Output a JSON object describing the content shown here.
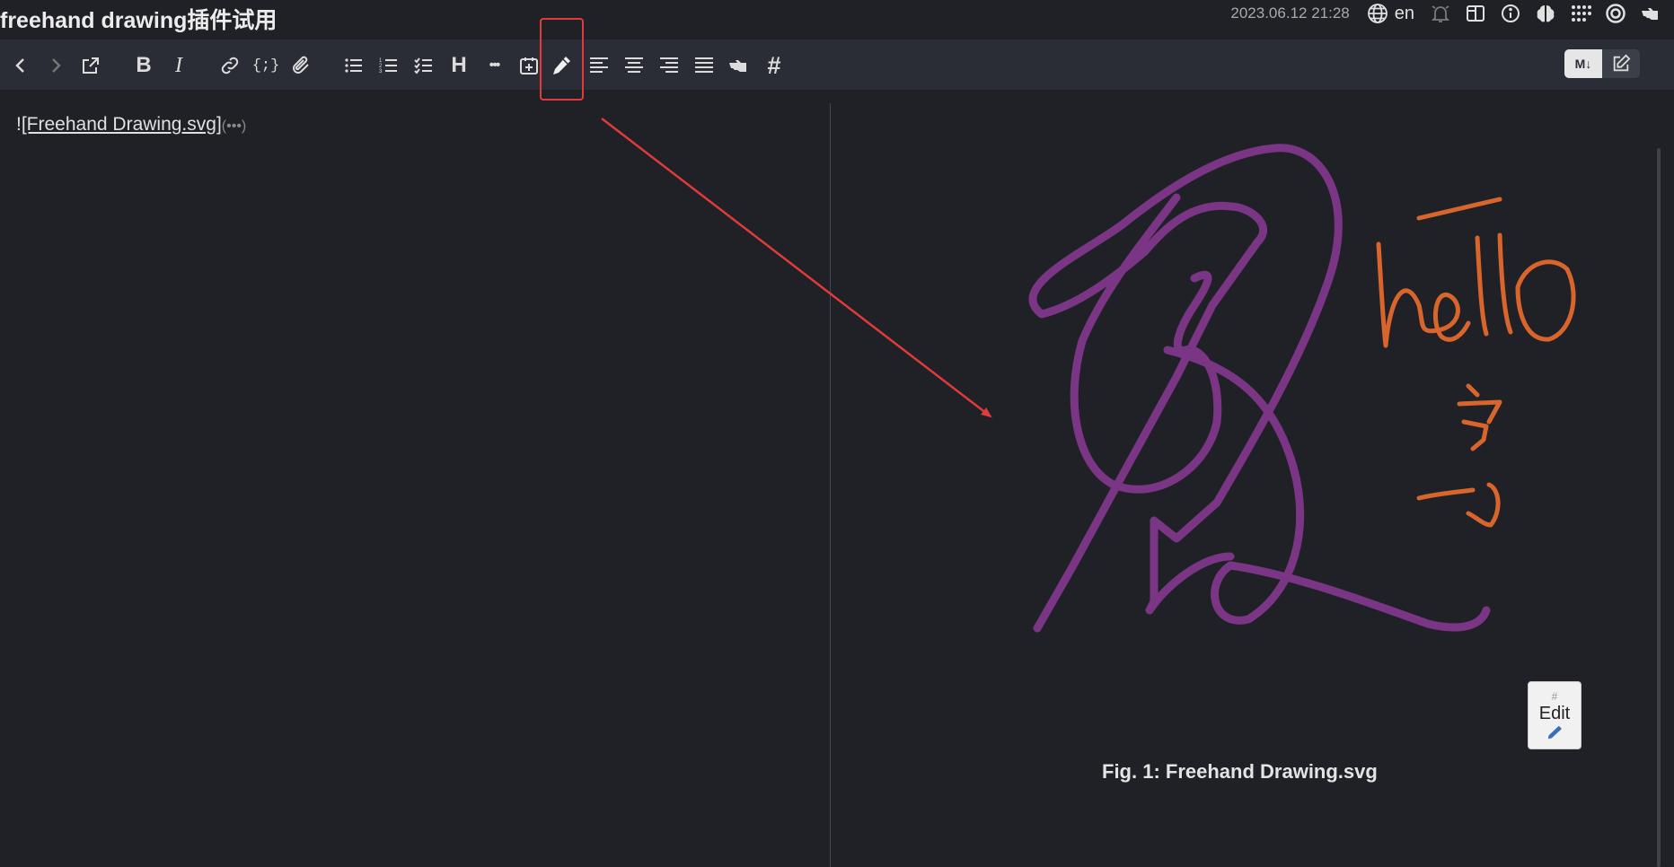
{
  "header": {
    "title": "freehand drawing插件试用",
    "timestamp": "2023.06.12 21:28",
    "language": "en",
    "status_icons": [
      "globe-icon",
      "bell-icon",
      "split-view-icon",
      "info-icon",
      "brain-icon",
      "grid-dots-icon",
      "target-icon",
      "pointing-hand-icon"
    ]
  },
  "toolbar": {
    "buttons": [
      "back",
      "forward",
      "open-external",
      "bold",
      "italic",
      "link",
      "code-block",
      "attachment",
      "bullet-list",
      "numbered-list",
      "task-list",
      "heading",
      "horizontal-rule",
      "insert-date",
      "freehand-drawing",
      "align-left",
      "align-center",
      "align-right",
      "align-justify",
      "pointing-hand",
      "tag"
    ],
    "bold_label": "B",
    "italic_label": "I",
    "code_label": "{;}",
    "heading_label": "H",
    "hr_label": "•••",
    "tag_label": "#",
    "mode_markdown_label": "M↓",
    "highlighted_button": "freehand-drawing"
  },
  "editor": {
    "prefix": "!",
    "link_text": "[Freehand Drawing.svg]",
    "collapsed_url": "(•••)"
  },
  "preview": {
    "edit_hash": "#",
    "edit_label": "Edit",
    "caption": "Fig. 1: Freehand Drawing.svg"
  },
  "colors": {
    "purple_stroke": "#7b3585",
    "orange_stroke": "#d8652c",
    "annotation_red": "#e03a3a",
    "background": "#1f2127",
    "toolbar": "#2a2d35"
  }
}
